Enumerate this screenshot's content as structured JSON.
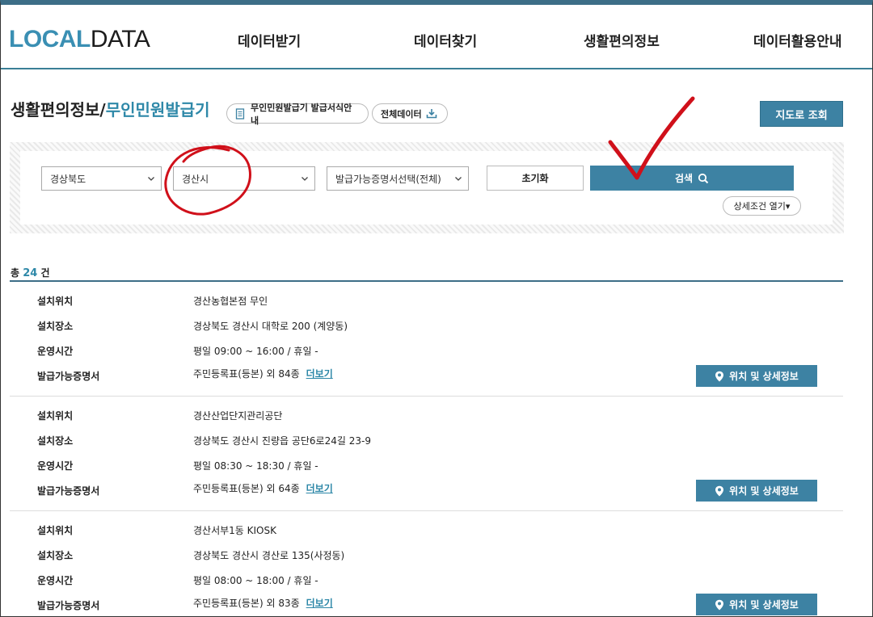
{
  "logo": {
    "part1": "LOCAL",
    "part2": "DATA"
  },
  "nav": [
    "데이터받기",
    "데이터찾기",
    "생활편의정보",
    "데이터활용안내"
  ],
  "page_title": {
    "prefix": "생활편의정보/",
    "accent": "무인민원발급기"
  },
  "pills": {
    "guide": "무인민원발급기 발급서식안내",
    "all_data": "전체데이터"
  },
  "map_button": "지도로 조회",
  "filters": {
    "province": "경상북도",
    "city": "경산시",
    "certificate": "발급가능증명서선택(전체)",
    "reset": "초기화",
    "search": "검색",
    "more_conditions": "상세조건 열기▾"
  },
  "total": {
    "prefix": "총",
    "count": "24",
    "suffix": "건"
  },
  "labels": {
    "location": "설치위치",
    "place": "설치장소",
    "hours": "운영시간",
    "certs": "발급가능증명서"
  },
  "detail_button": "위치 및 상세정보",
  "more_link": "더보기",
  "results": [
    {
      "location": "경산농협본점 무인",
      "place": "경상북도 경산시 대학로 200 (계양동)",
      "hours": "평일 09:00 ~ 16:00 / 휴일 -",
      "certs": "주민등록표(등본) 외 84종"
    },
    {
      "location": "경산산업단지관리공단",
      "place": "경상북도 경산시 진량읍 공단6로24길 23-9",
      "hours": "평일 08:30 ~ 18:30 / 휴일 -",
      "certs": "주민등록표(등본) 외 64종"
    },
    {
      "location": "경산서부1동 KIOSK",
      "place": "경상북도 경산시 경산로 135(사정동)",
      "hours": "평일 08:00 ~ 18:00 / 휴일 -",
      "certs": "주민등록표(등본) 외 83종"
    }
  ],
  "colors": {
    "accent": "#3d82a3",
    "link": "#2e88a8",
    "annotation": "#d0101a"
  }
}
